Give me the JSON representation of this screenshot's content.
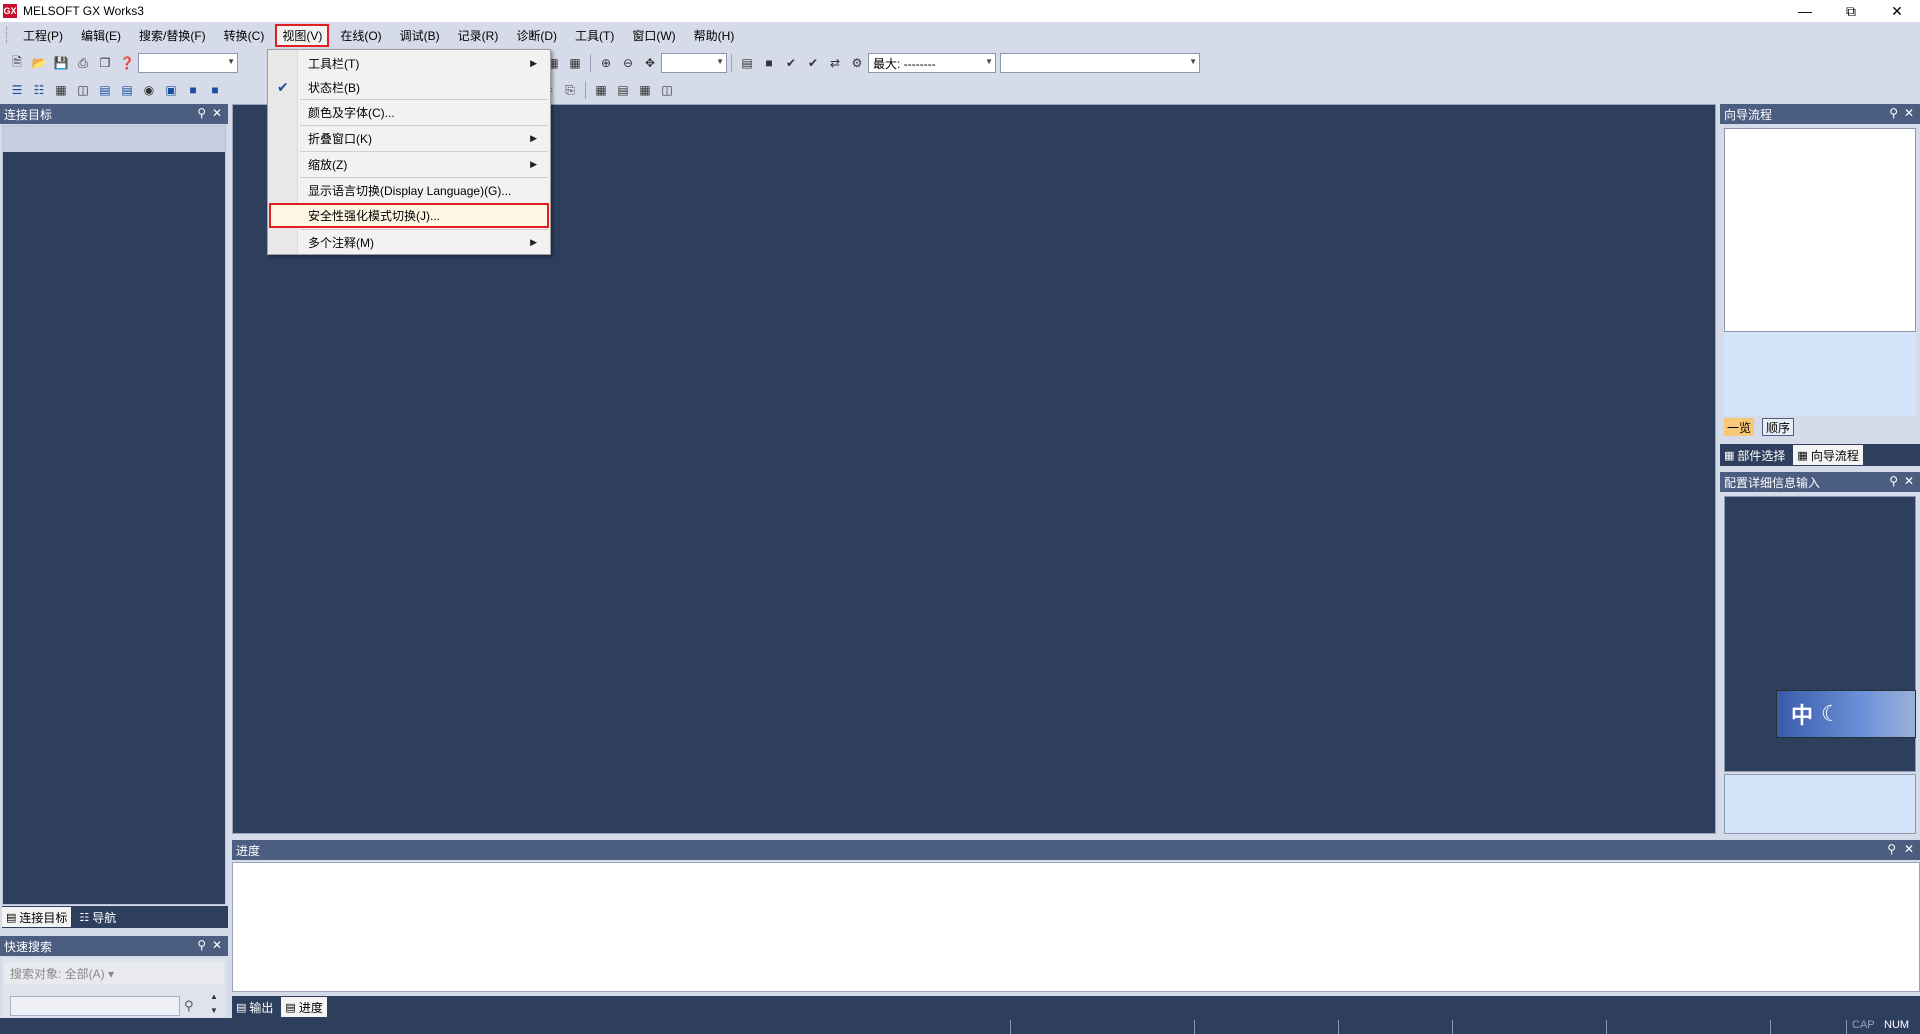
{
  "window": {
    "title": "MELSOFT GX Works3",
    "icon_text": "GX"
  },
  "menubar": {
    "items": [
      "工程(P)",
      "编辑(E)",
      "搜索/替换(F)",
      "转换(C)",
      "视图(V)",
      "在线(O)",
      "调试(B)",
      "记录(R)",
      "诊断(D)",
      "工具(T)",
      "窗口(W)",
      "帮助(H)"
    ],
    "active_index": 4
  },
  "toolbar": {
    "combo_max_label": "最大: --------"
  },
  "view_menu": {
    "items": [
      {
        "label": "工具栏(T)",
        "submenu": true,
        "checked": false
      },
      {
        "label": "状态栏(B)",
        "submenu": false,
        "checked": true
      },
      {
        "label": "颜色及字体(C)...",
        "submenu": false,
        "checked": false
      },
      {
        "label": "折叠窗口(K)",
        "submenu": true,
        "checked": false
      },
      {
        "label": "缩放(Z)",
        "submenu": true,
        "checked": false
      },
      {
        "label": "显示语言切换(Display Language)(G)...",
        "submenu": false,
        "checked": false
      },
      {
        "label": "安全性强化模式切换(J)...",
        "submenu": false,
        "checked": false,
        "highlighted": true
      },
      {
        "label": "多个注释(M)",
        "submenu": true,
        "checked": false
      }
    ]
  },
  "left_panel": {
    "title": "连接目标",
    "tabs": [
      "连接目标",
      "导航"
    ]
  },
  "quick_search": {
    "title": "快速搜索",
    "target_label": "搜索对象: 全部(A)"
  },
  "right_panel_top": {
    "title": "向导流程",
    "subtabs": [
      "一览",
      "顺序"
    ],
    "bottom_tabs": [
      "部件选择",
      "向导流程"
    ]
  },
  "right_panel_mid": {
    "title": "配置详细信息输入"
  },
  "output_panel": {
    "title": "进度",
    "tabs": [
      "输出",
      "进度"
    ]
  },
  "ime": {
    "text": "中"
  },
  "statusbar": {
    "cap": "CAP",
    "num": "NUM"
  },
  "colors": {
    "panel_header": "#4b5d80",
    "workspace": "#2e3f5e",
    "highlight_border": "#e02020"
  }
}
